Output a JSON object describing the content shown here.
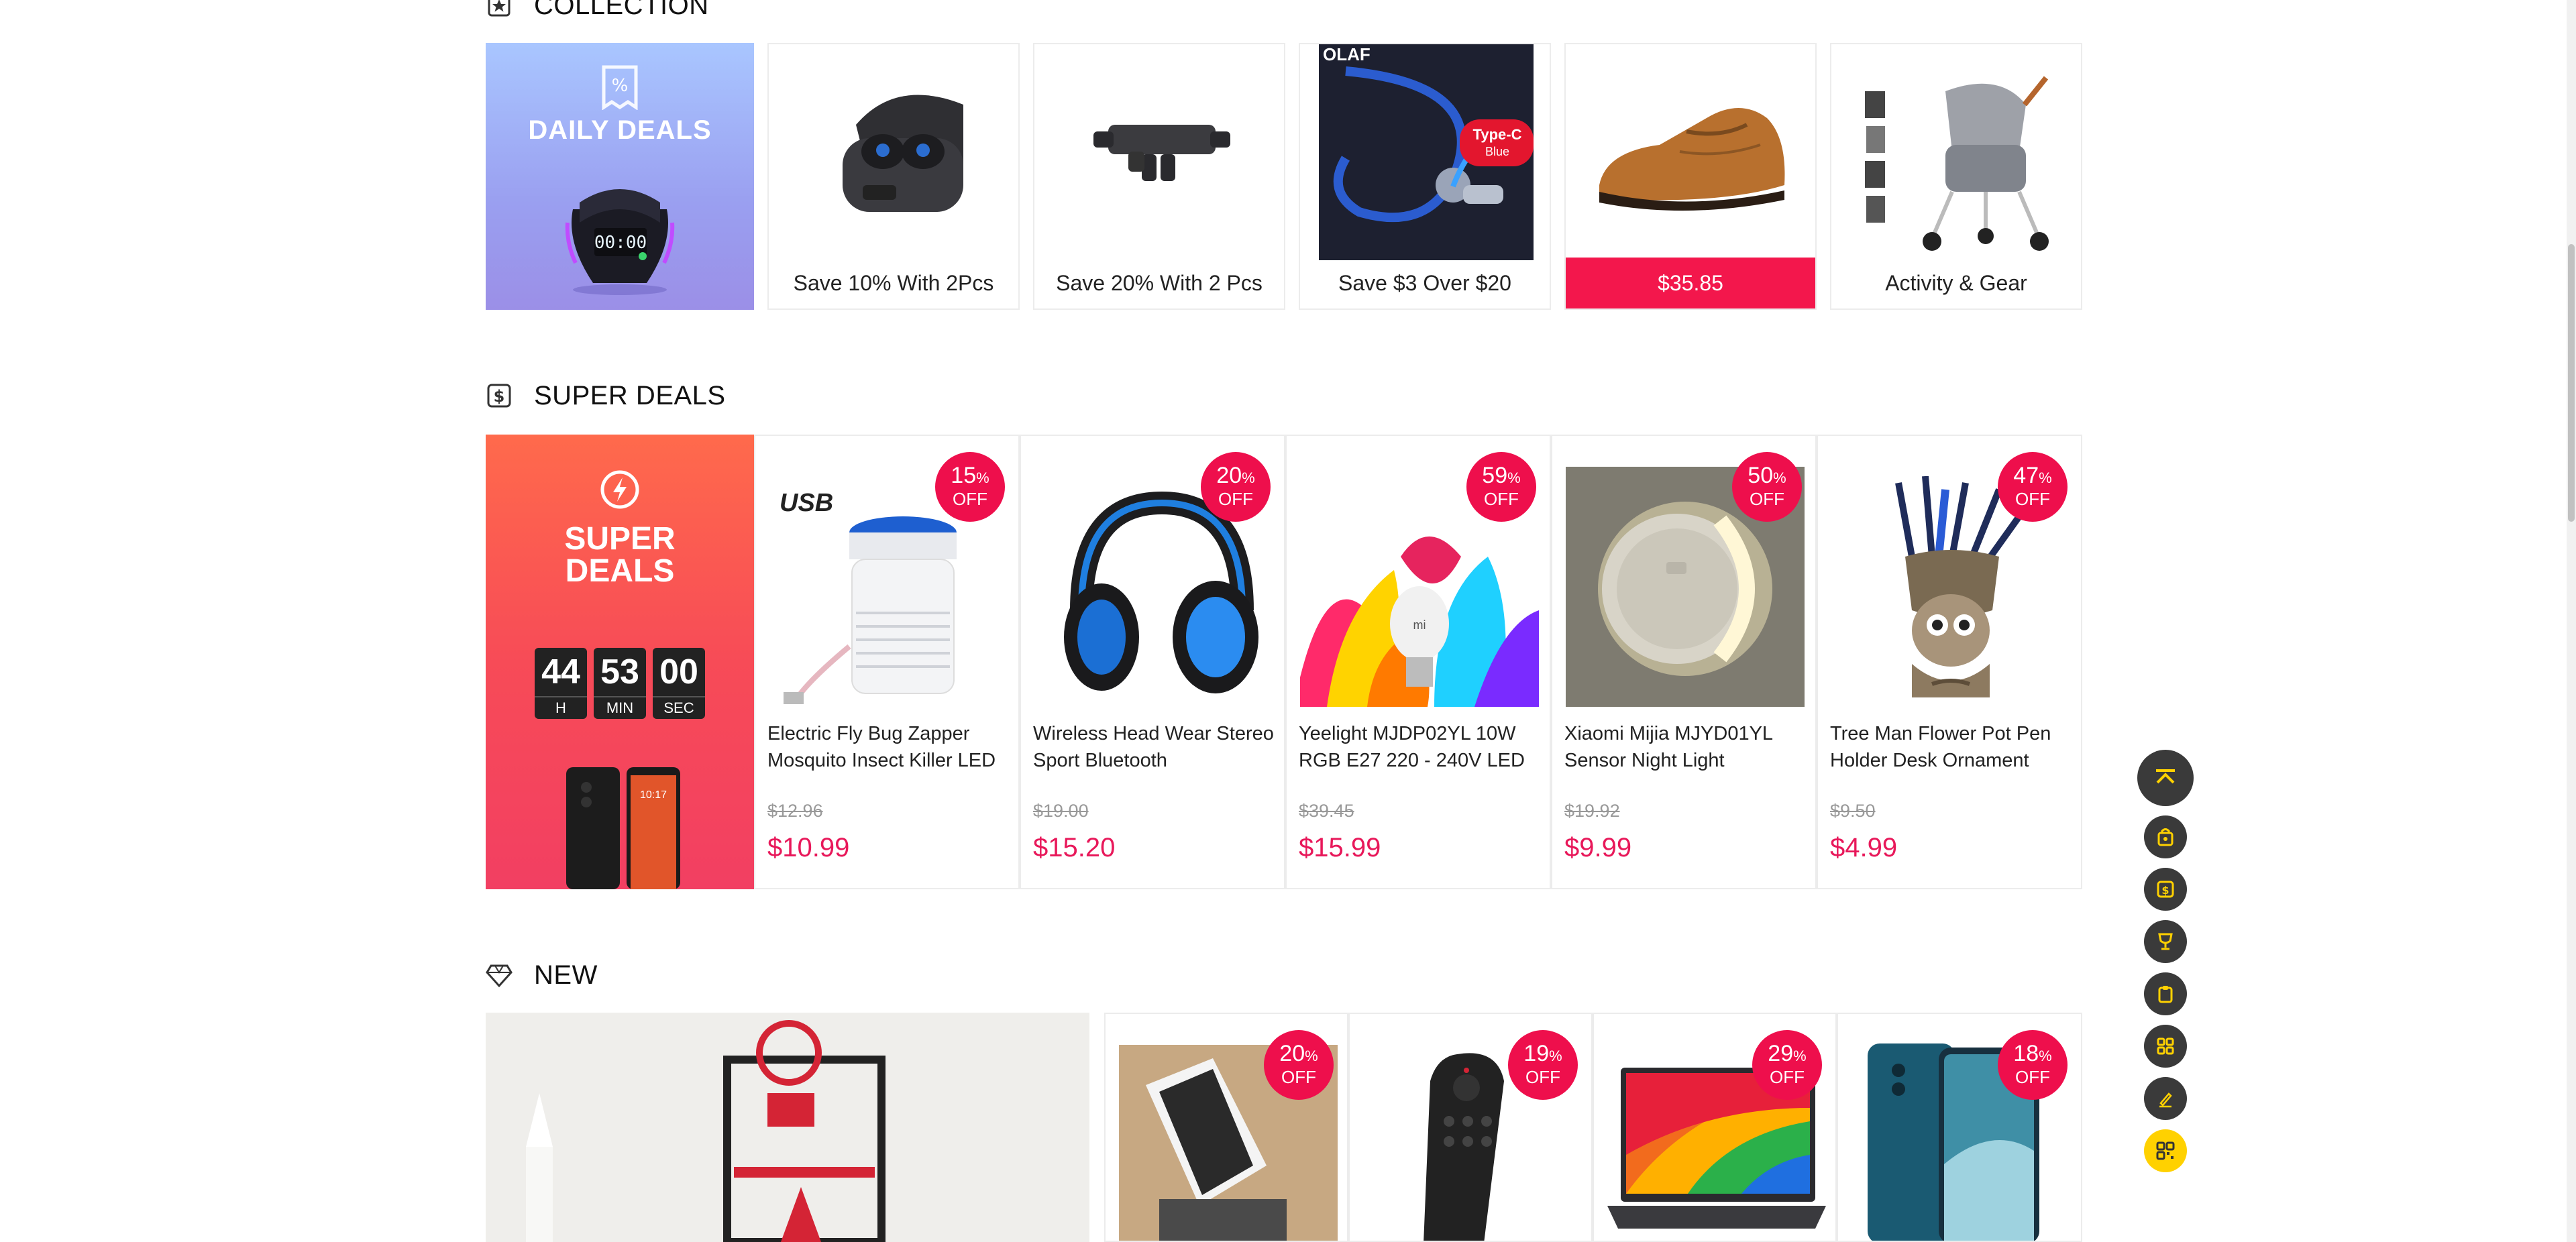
{
  "collection": {
    "title": "COLLECTION",
    "daily_deals_label": "DAILY DEALS",
    "daily_clock_text": "00:00",
    "items": [
      {
        "caption": "Save 10% With 2Pcs"
      },
      {
        "caption": "Save 20% With 2 Pcs"
      },
      {
        "caption": "Save $3 Over $20",
        "image_text": "Type-C",
        "image_subtext": "Blue",
        "image_brand": "OLAF"
      },
      {
        "caption": "$35.85"
      },
      {
        "caption": "Activity & Gear"
      }
    ]
  },
  "super_deals": {
    "title": "SUPER DEALS",
    "banner_title_line1": "SUPER",
    "banner_title_line2": "DEALS",
    "timer": [
      {
        "value": "44",
        "unit": "H"
      },
      {
        "value": "53",
        "unit": "MIN"
      },
      {
        "value": "00",
        "unit": "SEC"
      }
    ],
    "phone_time": "10:17",
    "products": [
      {
        "name": "Electric Fly Bug Zapper Mosquito Insect Killer LED",
        "old_price": "$12.96",
        "price": "$10.99",
        "discount": "15",
        "off_label": "OFF",
        "image_text": "USB"
      },
      {
        "name": "Wireless Head Wear Stereo Sport Bluetooth",
        "old_price": "$19.00",
        "price": "$15.20",
        "discount": "20",
        "off_label": "OFF"
      },
      {
        "name": "Yeelight MJDP02YL 10W RGB E27 220 - 240V LED",
        "old_price": "$39.45",
        "price": "$15.99",
        "discount": "59",
        "off_label": "OFF",
        "image_text": "mi"
      },
      {
        "name": "Xiaomi Mijia MJYD01YL Sensor Night Light",
        "old_price": "$19.92",
        "price": "$9.99",
        "discount": "50",
        "off_label": "OFF"
      },
      {
        "name": "Tree Man Flower Pot Pen Holder Desk Ornament",
        "old_price": "$9.50",
        "price": "$4.99",
        "discount": "47",
        "off_label": "OFF"
      }
    ]
  },
  "new_section": {
    "title": "NEW",
    "products": [
      {
        "discount": "20",
        "off_label": "OFF"
      },
      {
        "discount": "19",
        "off_label": "OFF"
      },
      {
        "discount": "29",
        "off_label": "OFF"
      },
      {
        "discount": "18",
        "off_label": "OFF"
      }
    ]
  },
  "colors": {
    "accent_red": "#ee0f4c",
    "price_red": "#e8185a",
    "nav_yellow": "#ffd100",
    "nav_dark": "#3a3a3a"
  },
  "floating_nav": [
    "back-to-top-icon",
    "shopping-bag-icon",
    "dollar-icon",
    "trophy-icon",
    "clipboard-icon",
    "grid-icon",
    "pencil-icon",
    "qr-code-icon"
  ]
}
